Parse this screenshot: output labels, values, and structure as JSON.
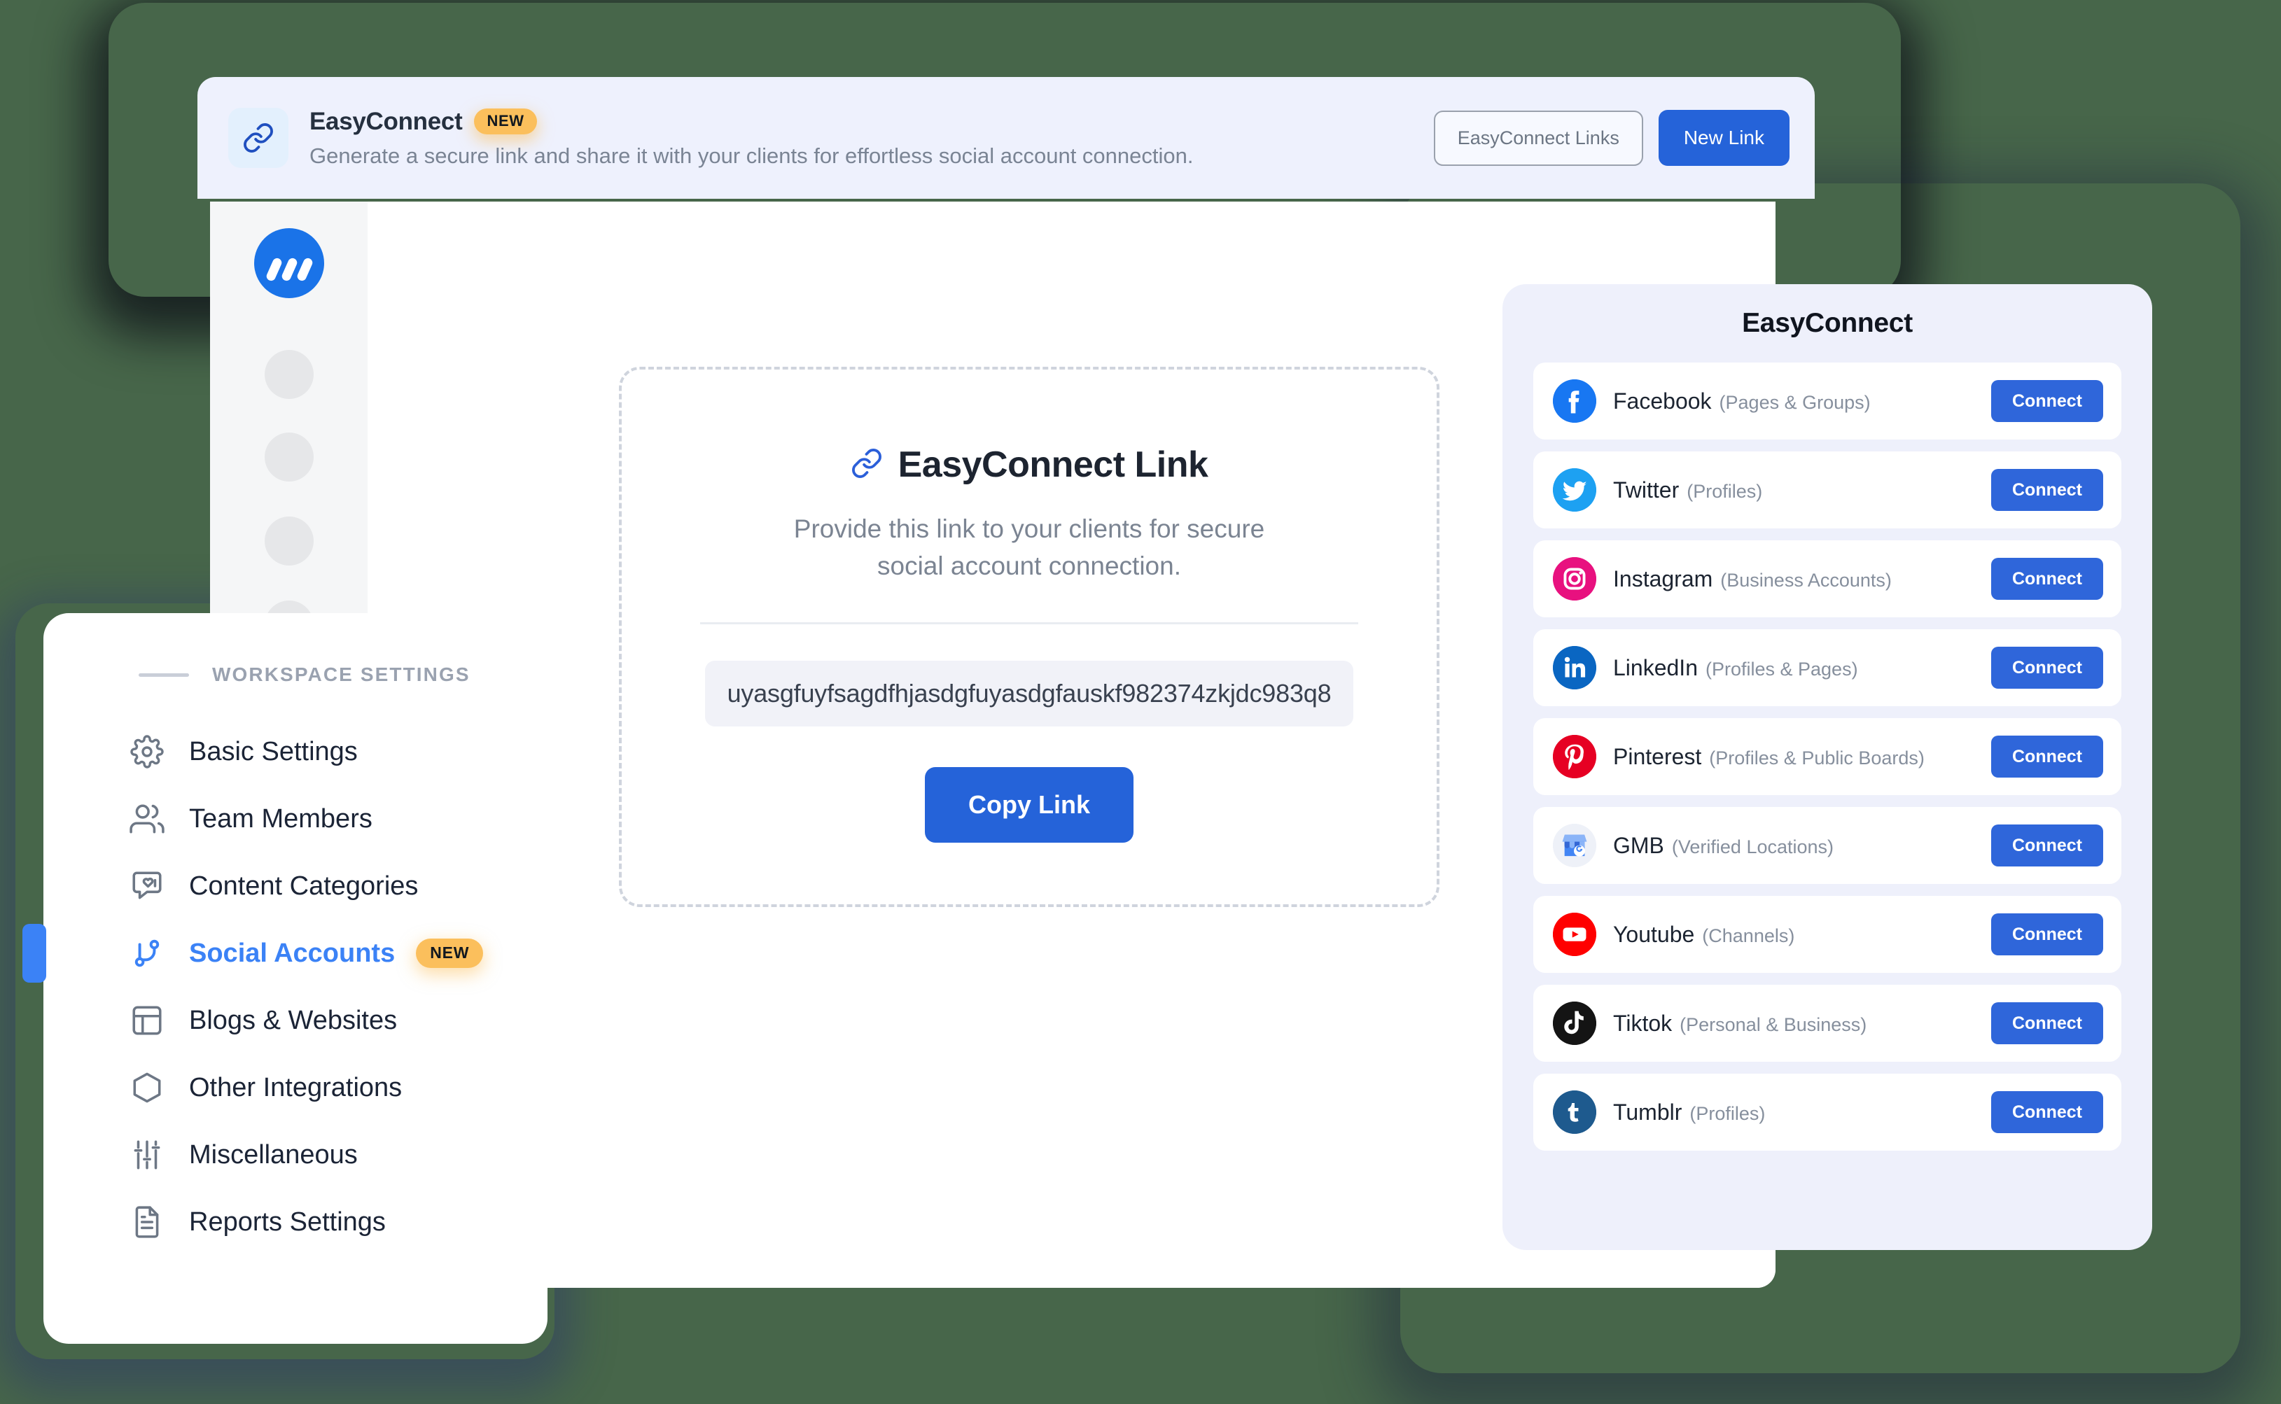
{
  "banner": {
    "icon": "link-icon",
    "title": "EasyConnect",
    "badge": "NEW",
    "subtitle": "Generate a secure link and share it with your clients for effortless social account connection.",
    "links_button": "EasyConnect Links",
    "new_link_button": "New Link"
  },
  "app": {
    "logo_name": "contentstudio-logo"
  },
  "link_card": {
    "icon": "link-icon",
    "title": "EasyConnect Link",
    "description": "Provide this link to your clients for secure social account connection.",
    "link_value": "uyasgfuyfsagdfhjasdgfuyasdgfauskf982374zkjdc983q8",
    "copy_button": "Copy Link"
  },
  "workspace": {
    "header": "WORKSPACE SETTINGS",
    "items": [
      {
        "label": "Basic Settings",
        "icon": "gear-icon",
        "active": false,
        "badge": null
      },
      {
        "label": "Team Members",
        "icon": "users-icon",
        "active": false,
        "badge": null
      },
      {
        "label": "Content Categories",
        "icon": "chat-heart-icon",
        "active": false,
        "badge": null
      },
      {
        "label": "Social Accounts",
        "icon": "branch-icon",
        "active": true,
        "badge": "NEW"
      },
      {
        "label": "Blogs & Websites",
        "icon": "layout-icon",
        "active": false,
        "badge": null
      },
      {
        "label": "Other Integrations",
        "icon": "hexagon-icon",
        "active": false,
        "badge": null
      },
      {
        "label": "Miscellaneous",
        "icon": "sliders-icon",
        "active": false,
        "badge": null
      },
      {
        "label": "Reports Settings",
        "icon": "document-icon",
        "active": false,
        "badge": null
      }
    ]
  },
  "easyconnect_panel": {
    "title": "EasyConnect",
    "connect_label": "Connect",
    "accounts": [
      {
        "platform": "Facebook",
        "scope": "(Pages & Groups)",
        "icon": "facebook-icon",
        "brand": "facebook",
        "color": "#1877f2"
      },
      {
        "platform": "Twitter",
        "scope": "(Profiles)",
        "icon": "twitter-icon",
        "brand": "twitter",
        "color": "#1da1f2"
      },
      {
        "platform": "Instagram",
        "scope": "(Business Accounts)",
        "icon": "instagram-icon",
        "brand": "instagram",
        "color": "#e8117f"
      },
      {
        "platform": "LinkedIn",
        "scope": "(Profiles & Pages)",
        "icon": "linkedin-icon",
        "brand": "linkedin",
        "color": "#0a66c2"
      },
      {
        "platform": "Pinterest",
        "scope": "(Profiles & Public Boards)",
        "icon": "pinterest-icon",
        "brand": "pinterest",
        "color": "#e60023"
      },
      {
        "platform": "GMB",
        "scope": "(Verified Locations)",
        "icon": "gmb-icon",
        "brand": "gmb",
        "color": "#4285f4"
      },
      {
        "platform": "Youtube",
        "scope": "(Channels)",
        "icon": "youtube-icon",
        "brand": "youtube",
        "color": "#ff0000"
      },
      {
        "platform": "Tiktok",
        "scope": "(Personal & Business)",
        "icon": "tiktok-icon",
        "brand": "tiktok",
        "color": "#141414"
      },
      {
        "platform": "Tumblr",
        "scope": "(Profiles)",
        "icon": "tumblr-icon",
        "brand": "tumblr",
        "color": "#1e5a8e"
      }
    ]
  },
  "theme": {
    "background": "#47664a",
    "accent_blue": "#2563d9",
    "badge_amber": "#fbbf5c",
    "panel_tint": "#eef0fb"
  }
}
